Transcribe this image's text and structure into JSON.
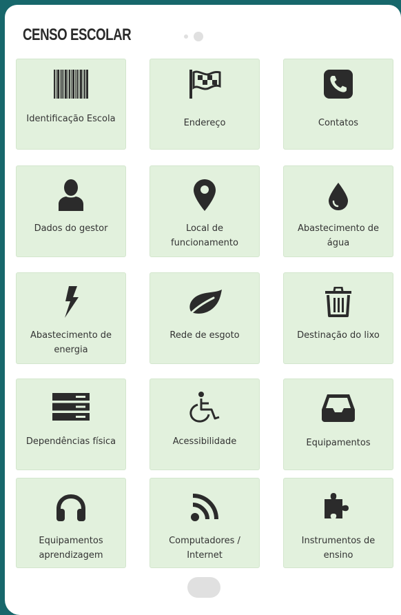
{
  "header": {
    "title": "CENSO ESCOLAR"
  },
  "tiles": [
    {
      "label": "Identificação Escola",
      "icon": "barcode-icon"
    },
    {
      "label": "Endereço",
      "icon": "flag-checkered-icon"
    },
    {
      "label": "Contatos",
      "icon": "phone-square-icon"
    },
    {
      "label": "Dados do gestor",
      "icon": "user-icon"
    },
    {
      "label": "Local de funcionamento",
      "icon": "map-marker-icon"
    },
    {
      "label": "Abastecimento de água",
      "icon": "tint-icon"
    },
    {
      "label": "Abastecimento de energia",
      "icon": "bolt-icon"
    },
    {
      "label": "Rede de esgoto",
      "icon": "leaf-icon"
    },
    {
      "label": "Destinação do lixo",
      "icon": "trash-icon"
    },
    {
      "label": "Dependências física",
      "icon": "server-icon"
    },
    {
      "label": "Acessibilidade",
      "icon": "wheelchair-icon"
    },
    {
      "label": "Equipamentos",
      "icon": "inbox-icon"
    },
    {
      "label": "Equipamentos aprendizagem",
      "icon": "headphones-icon"
    },
    {
      "label": "Computadores / Internet",
      "icon": "rss-icon"
    },
    {
      "label": "Instrumentos de ensino",
      "icon": "puzzle-piece-icon"
    }
  ],
  "colors": {
    "background": "#17676b",
    "tile": "#e2f1dd",
    "icon": "#2b2b2b"
  }
}
